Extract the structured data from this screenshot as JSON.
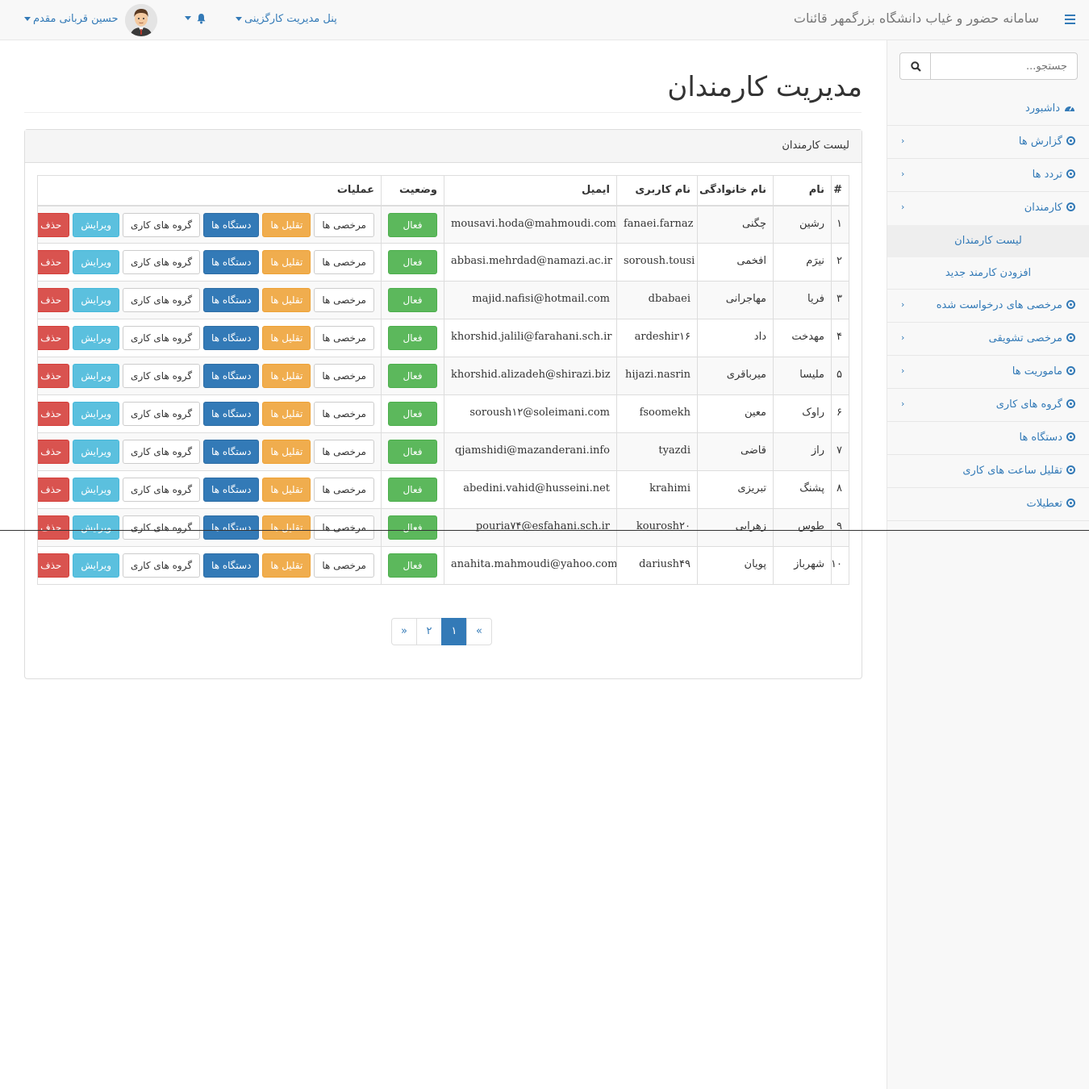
{
  "navbar": {
    "brand": "سامانه حضور و غیاب دانشگاه بزرگمهر قائنات",
    "panel_menu": "پنل مدیریت کارگزینی",
    "user_name": "حسین قربانی مقدم"
  },
  "sidebar": {
    "search_placeholder": "جستجو...",
    "items": [
      {
        "label": "داشبورد",
        "icon": "dashboard-icon"
      },
      {
        "label": "گزارش ها",
        "icon": "circle-dot-icon"
      },
      {
        "label": "تردد ها",
        "icon": "circle-dot-icon"
      },
      {
        "label": "کارمندان",
        "icon": "circle-dot-icon"
      },
      {
        "label": "مرخصی های درخواست شده",
        "icon": "circle-dot-icon"
      },
      {
        "label": "مرخصی تشویقی",
        "icon": "circle-dot-icon"
      },
      {
        "label": "ماموریت ها",
        "icon": "circle-dot-icon"
      },
      {
        "label": "گروه های کاری",
        "icon": "circle-dot-icon"
      },
      {
        "label": "دستگاه ها",
        "icon": "circle-dot-icon"
      },
      {
        "label": "تقلیل ساعت های کاری",
        "icon": "circle-dot-icon"
      },
      {
        "label": "تعطیلات",
        "icon": "circle-dot-icon"
      }
    ],
    "sub_items": [
      {
        "label": "لیست کارمندان",
        "active": true
      },
      {
        "label": "افزودن کارمند جدید",
        "active": false
      }
    ]
  },
  "main": {
    "title": "مدیریت کارمندان",
    "panel_title": "لیست کارمندان",
    "columns": [
      "#",
      "نام",
      "نام خانوادگی",
      "نام کاربری",
      "ایمیل",
      "وضعیت",
      "عملیات"
    ],
    "status_label": "فعال",
    "actions": {
      "leaves": "مرخصی ها",
      "reductions": "تقلیل ها",
      "devices": "دستگاه ها",
      "work_groups": "گروه های کاری",
      "edit": "ویرایش",
      "delete": "حذف"
    },
    "rows": [
      {
        "num": "۱",
        "first": "رشین",
        "last": "چگنی",
        "username": "fanaei.farnaz",
        "email": "mousavi.hoda@mahmoudi.com"
      },
      {
        "num": "۲",
        "first": "نیرَم",
        "last": "افخمی",
        "username": "soroush.tousi",
        "email": "abbasi.mehrdad@namazi.ac.ir"
      },
      {
        "num": "۳",
        "first": "فریا",
        "last": "مهاجرانی",
        "username": "dbabaei",
        "email": "majid.nafisi@hotmail.com"
      },
      {
        "num": "۴",
        "first": "مهدخت",
        "last": "داد",
        "username": "ardeshir۱۶",
        "email": "khorshid.jalili@farahani.sch.ir"
      },
      {
        "num": "۵",
        "first": "ملیسا",
        "last": "میرباقری",
        "username": "hijazi.nasrin",
        "email": "khorshid.alizadeh@shirazi.biz"
      },
      {
        "num": "۶",
        "first": "راوک",
        "last": "معین",
        "username": "fsoomekh",
        "email": "soroush۱۲@soleimani.com"
      },
      {
        "num": "۷",
        "first": "راز",
        "last": "قاضی",
        "username": "tyazdi",
        "email": "qjamshidi@mazanderani.info"
      },
      {
        "num": "۸",
        "first": "پشنگ",
        "last": "تبریزی",
        "username": "krahimi",
        "email": "abedini.vahid@husseini.net"
      },
      {
        "num": "۹",
        "first": "طوس",
        "last": "زهرایی",
        "username": "kourosh۲۰",
        "email": "pouria۷۴@esfahani.sch.ir"
      },
      {
        "num": "۱۰",
        "first": "شهرباز",
        "last": "پویان",
        "username": "dariush۴۹",
        "email": "anahita.mahmoudi@yahoo.com"
      }
    ],
    "pagination": {
      "prev": "«",
      "pages": [
        "۱",
        "۲"
      ],
      "active_page": "۱",
      "next": "»"
    }
  },
  "colors": {
    "primary": "#337ab7",
    "success": "#5cb85c",
    "warning": "#f0ad4e",
    "info": "#5bc0de",
    "danger": "#d9534f"
  }
}
